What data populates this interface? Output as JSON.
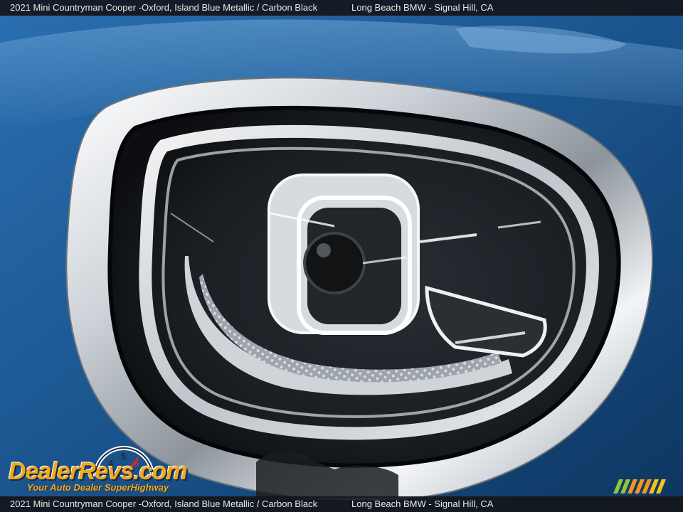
{
  "caption": {
    "vehicle": "2021 Mini Countryman Cooper -Oxford,  Island Blue Metallic / Carbon Black",
    "dealer": "Long Beach BMW - Signal Hill, CA"
  },
  "watermark": {
    "brand": "DealerRevs.com",
    "tagline": "Your Auto Dealer SuperHighway",
    "gauge_numbers": [
      "4",
      "5",
      "6"
    ]
  },
  "colors": {
    "paint": "#1f5a94",
    "chrome": "#e9ecef",
    "lens_dark": "#1c1f24",
    "led_ring": "#f4f6f8",
    "watermark_orange": "#f2a81c",
    "stripe_green": "#8cc63f",
    "stripe_orange": "#f7941d"
  }
}
